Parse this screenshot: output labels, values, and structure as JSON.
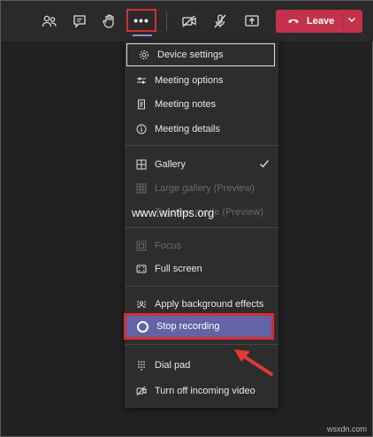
{
  "toolbar": {
    "icons": [
      "participants-icon",
      "chat-icon",
      "raise-hand-icon",
      "more-actions-icon",
      "camera-off-icon",
      "mic-off-icon",
      "share-tray-icon"
    ],
    "more_label": "•••",
    "leave_label": "Leave"
  },
  "menu": {
    "items": [
      {
        "label": "Device settings",
        "icon": "gear-icon"
      },
      {
        "label": "Meeting options",
        "icon": "sliders-icon"
      },
      {
        "label": "Meeting notes",
        "icon": "notes-icon"
      },
      {
        "label": "Meeting details",
        "icon": "info-icon"
      },
      {
        "label": "Gallery",
        "icon": "gallery-icon",
        "checked": true
      },
      {
        "label": "Large gallery (Preview)",
        "icon": "large-gallery-icon",
        "disabled": true
      },
      {
        "label": "Together mode (Preview)",
        "icon": "together-mode-icon",
        "disabled": true
      },
      {
        "label": "Focus",
        "icon": "focus-icon",
        "disabled": true
      },
      {
        "label": "Full screen",
        "icon": "fullscreen-icon"
      },
      {
        "label": "Apply background effects",
        "icon": "background-effects-icon"
      },
      {
        "label": "Stop recording",
        "icon": "record-icon"
      },
      {
        "label": "Dial pad",
        "icon": "dialpad-icon"
      },
      {
        "label": "Turn off incoming video",
        "icon": "video-off-icon"
      }
    ]
  },
  "watermark": "www.wintips.org",
  "footer": "wsxdn.com",
  "colors": {
    "accent": "#6264a7",
    "leave": "#c4314b",
    "highlight": "#d32f2f"
  }
}
